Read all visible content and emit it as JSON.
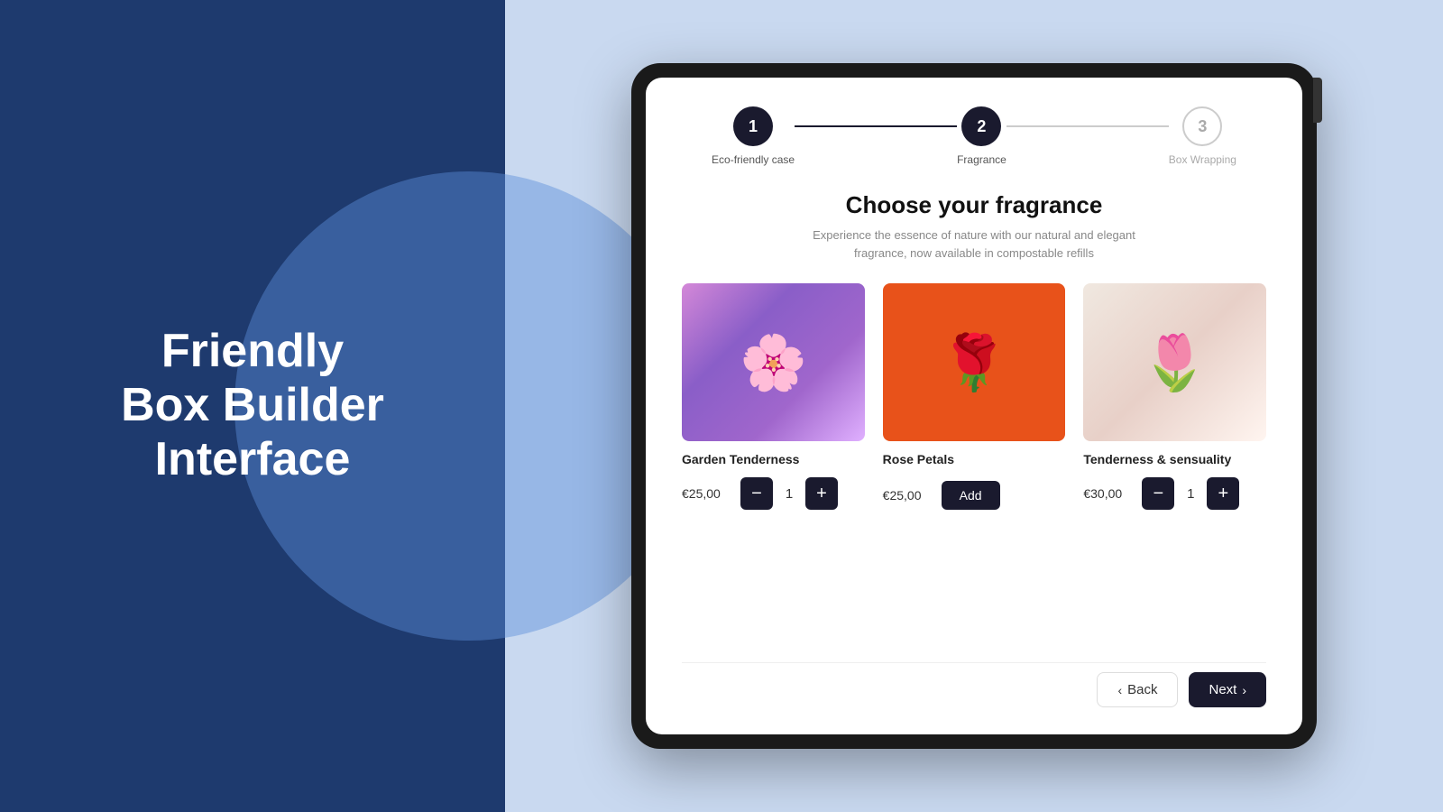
{
  "left": {
    "title_line1": "Friendly",
    "title_line2": "Box Builder",
    "title_line3": "Interface"
  },
  "stepper": {
    "steps": [
      {
        "number": "1",
        "label": "Eco-friendly case",
        "state": "active"
      },
      {
        "number": "2",
        "label": "Fragrance",
        "state": "active"
      },
      {
        "number": "3",
        "label": "Box Wrapping",
        "state": "inactive"
      }
    ],
    "lines": [
      "done",
      "todo"
    ]
  },
  "section": {
    "title": "Choose your fragrance",
    "subtitle": "Experience the essence of nature with our natural and elegant\nfragrance, now available in compostable refills"
  },
  "products": [
    {
      "id": "garden",
      "name": "Garden Tenderness",
      "price": "€25,00",
      "qty": "1",
      "has_qty": true
    },
    {
      "id": "rose",
      "name": "Rose Petals",
      "price": "€25,00",
      "qty": null,
      "has_qty": false,
      "add_label": "Add"
    },
    {
      "id": "tenderness",
      "name": "Tenderness & sensuality",
      "price": "€30,00",
      "qty": "1",
      "has_qty": true
    }
  ],
  "navigation": {
    "back_label": "Back",
    "next_label": "Next"
  }
}
